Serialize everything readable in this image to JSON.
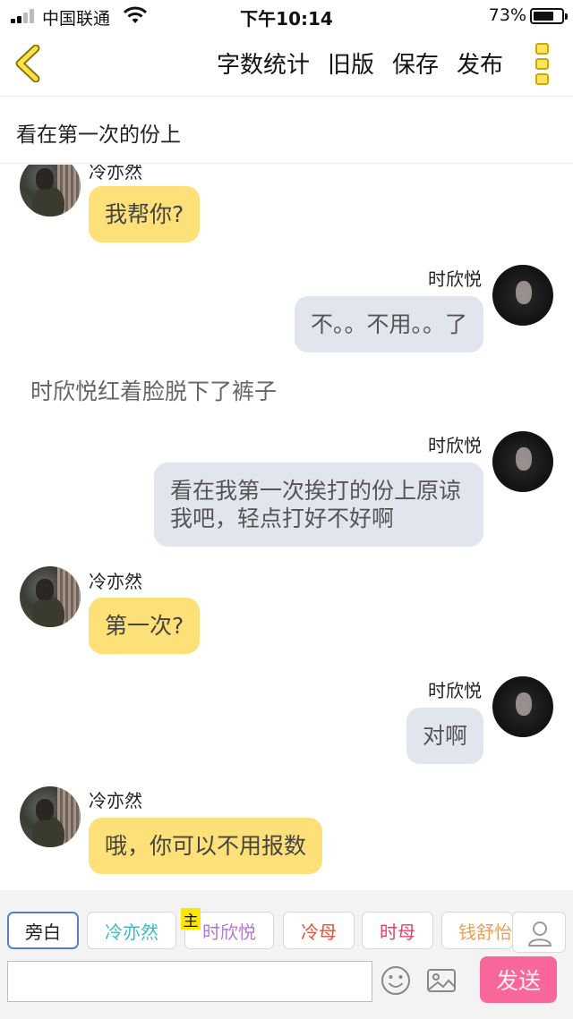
{
  "status_bar": {
    "carrier": "中国联通",
    "time": "下午10:14",
    "battery_percent": "73%",
    "battery_level": 0.73
  },
  "nav": {
    "actions": [
      "字数统计",
      "旧版",
      "保存",
      "发布"
    ]
  },
  "story": {
    "title": "看在第一次的份上"
  },
  "messages": [
    {
      "type": "left",
      "speaker": "冷亦然",
      "text": "我帮你?"
    },
    {
      "type": "right",
      "speaker": "时欣悦",
      "text": "不。。不用。。了"
    },
    {
      "type": "narration",
      "text": "时欣悦红着脸脱下了裤子"
    },
    {
      "type": "right",
      "speaker": "时欣悦",
      "text": "看在我第一次挨打的份上原谅我吧，轻点打好不好啊"
    },
    {
      "type": "left",
      "speaker": "冷亦然",
      "text": "第一次?"
    },
    {
      "type": "right",
      "speaker": "时欣悦",
      "text": "对啊"
    },
    {
      "type": "left",
      "speaker": "冷亦然",
      "text": "哦，你可以不用报数"
    }
  ],
  "roles": [
    {
      "label": "旁白",
      "color": "#222222"
    },
    {
      "label": "冷亦然",
      "color": "#3fb8c6"
    },
    {
      "label": "时欣悦",
      "color": "#b07ad0"
    },
    {
      "label": "冷母",
      "color": "#e0533a"
    },
    {
      "label": "时母",
      "color": "#e0436a"
    },
    {
      "label": "钱舒怡",
      "color": "#e8a05a"
    }
  ],
  "role_badge": "主",
  "composer": {
    "input_value": "",
    "send_label": "发送"
  }
}
